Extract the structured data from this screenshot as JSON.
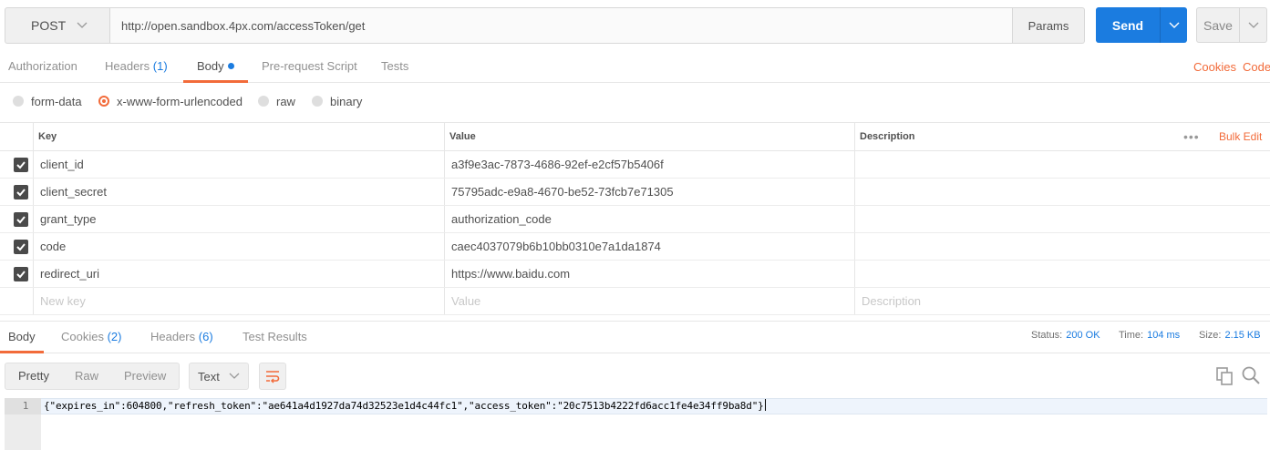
{
  "request": {
    "method": "POST",
    "url": "http://open.sandbox.4px.com/accessToken/get",
    "params_label": "Params",
    "send_label": "Send",
    "save_label": "Save"
  },
  "request_tabs": [
    {
      "label": "Authorization",
      "count": ""
    },
    {
      "label": "Headers",
      "count": "(1)"
    },
    {
      "label": "Body",
      "count": ""
    },
    {
      "label": "Pre-request Script",
      "count": ""
    },
    {
      "label": "Tests",
      "count": ""
    }
  ],
  "right_links": {
    "cookies": "Cookies",
    "code": "Code"
  },
  "body_types": [
    "form-data",
    "x-www-form-urlencoded",
    "raw",
    "binary"
  ],
  "selected_body_type": "x-www-form-urlencoded",
  "table": {
    "headers": {
      "key": "Key",
      "value": "Value",
      "description": "Description"
    },
    "bulk_edit": "Bulk Edit",
    "more": "•••",
    "rows": [
      {
        "key": "client_id",
        "value": "a3f9e3ac-7873-4686-92ef-e2cf57b5406f",
        "description": "",
        "checked": true
      },
      {
        "key": "client_secret",
        "value": "75795adc-e9a8-4670-be52-73fcb7e71305",
        "description": "",
        "checked": true
      },
      {
        "key": "grant_type",
        "value": "authorization_code",
        "description": "",
        "checked": true
      },
      {
        "key": "code",
        "value": "caec4037079b6b10bb0310e7a1da1874",
        "description": "",
        "checked": true
      },
      {
        "key": "redirect_uri",
        "value": "https://www.baidu.com",
        "description": "",
        "checked": true
      }
    ],
    "placeholders": {
      "key": "New key",
      "value": "Value",
      "description": "Description"
    }
  },
  "response_tabs": [
    {
      "label": "Body",
      "count": ""
    },
    {
      "label": "Cookies",
      "count": "(2)"
    },
    {
      "label": "Headers",
      "count": "(6)"
    },
    {
      "label": "Test Results",
      "count": ""
    }
  ],
  "response_meta": {
    "status_label": "Status:",
    "status_value": "200 OK",
    "time_label": "Time:",
    "time_value": "104 ms",
    "size_label": "Size:",
    "size_value": "2.15 KB"
  },
  "view_modes": [
    "Pretty",
    "Raw",
    "Preview"
  ],
  "format": "Text",
  "editor": {
    "line_number": "1",
    "content": "{\"expires_in\":604800,\"refresh_token\":\"ae641a4d1927da74d32523e1d4c44fc1\",\"access_token\":\"20c7513b4222fd6acc1fe4e34ff9ba8d\"}"
  },
  "colors": {
    "accent": "#f26b3a",
    "primary": "#1b7ce0"
  }
}
